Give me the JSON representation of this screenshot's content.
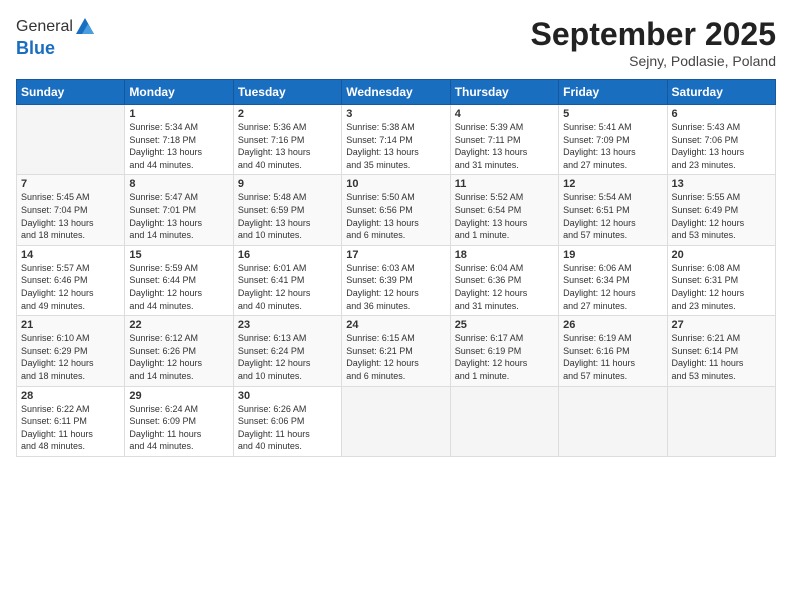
{
  "logo": {
    "general": "General",
    "blue": "Blue"
  },
  "header": {
    "month": "September 2025",
    "location": "Sejny, Podlasie, Poland"
  },
  "weekdays": [
    "Sunday",
    "Monday",
    "Tuesday",
    "Wednesday",
    "Thursday",
    "Friday",
    "Saturday"
  ],
  "weeks": [
    [
      {
        "day": "",
        "info": ""
      },
      {
        "day": "1",
        "info": "Sunrise: 5:34 AM\nSunset: 7:18 PM\nDaylight: 13 hours\nand 44 minutes."
      },
      {
        "day": "2",
        "info": "Sunrise: 5:36 AM\nSunset: 7:16 PM\nDaylight: 13 hours\nand 40 minutes."
      },
      {
        "day": "3",
        "info": "Sunrise: 5:38 AM\nSunset: 7:14 PM\nDaylight: 13 hours\nand 35 minutes."
      },
      {
        "day": "4",
        "info": "Sunrise: 5:39 AM\nSunset: 7:11 PM\nDaylight: 13 hours\nand 31 minutes."
      },
      {
        "day": "5",
        "info": "Sunrise: 5:41 AM\nSunset: 7:09 PM\nDaylight: 13 hours\nand 27 minutes."
      },
      {
        "day": "6",
        "info": "Sunrise: 5:43 AM\nSunset: 7:06 PM\nDaylight: 13 hours\nand 23 minutes."
      }
    ],
    [
      {
        "day": "7",
        "info": "Sunrise: 5:45 AM\nSunset: 7:04 PM\nDaylight: 13 hours\nand 18 minutes."
      },
      {
        "day": "8",
        "info": "Sunrise: 5:47 AM\nSunset: 7:01 PM\nDaylight: 13 hours\nand 14 minutes."
      },
      {
        "day": "9",
        "info": "Sunrise: 5:48 AM\nSunset: 6:59 PM\nDaylight: 13 hours\nand 10 minutes."
      },
      {
        "day": "10",
        "info": "Sunrise: 5:50 AM\nSunset: 6:56 PM\nDaylight: 13 hours\nand 6 minutes."
      },
      {
        "day": "11",
        "info": "Sunrise: 5:52 AM\nSunset: 6:54 PM\nDaylight: 13 hours\nand 1 minute."
      },
      {
        "day": "12",
        "info": "Sunrise: 5:54 AM\nSunset: 6:51 PM\nDaylight: 12 hours\nand 57 minutes."
      },
      {
        "day": "13",
        "info": "Sunrise: 5:55 AM\nSunset: 6:49 PM\nDaylight: 12 hours\nand 53 minutes."
      }
    ],
    [
      {
        "day": "14",
        "info": "Sunrise: 5:57 AM\nSunset: 6:46 PM\nDaylight: 12 hours\nand 49 minutes."
      },
      {
        "day": "15",
        "info": "Sunrise: 5:59 AM\nSunset: 6:44 PM\nDaylight: 12 hours\nand 44 minutes."
      },
      {
        "day": "16",
        "info": "Sunrise: 6:01 AM\nSunset: 6:41 PM\nDaylight: 12 hours\nand 40 minutes."
      },
      {
        "day": "17",
        "info": "Sunrise: 6:03 AM\nSunset: 6:39 PM\nDaylight: 12 hours\nand 36 minutes."
      },
      {
        "day": "18",
        "info": "Sunrise: 6:04 AM\nSunset: 6:36 PM\nDaylight: 12 hours\nand 31 minutes."
      },
      {
        "day": "19",
        "info": "Sunrise: 6:06 AM\nSunset: 6:34 PM\nDaylight: 12 hours\nand 27 minutes."
      },
      {
        "day": "20",
        "info": "Sunrise: 6:08 AM\nSunset: 6:31 PM\nDaylight: 12 hours\nand 23 minutes."
      }
    ],
    [
      {
        "day": "21",
        "info": "Sunrise: 6:10 AM\nSunset: 6:29 PM\nDaylight: 12 hours\nand 18 minutes."
      },
      {
        "day": "22",
        "info": "Sunrise: 6:12 AM\nSunset: 6:26 PM\nDaylight: 12 hours\nand 14 minutes."
      },
      {
        "day": "23",
        "info": "Sunrise: 6:13 AM\nSunset: 6:24 PM\nDaylight: 12 hours\nand 10 minutes."
      },
      {
        "day": "24",
        "info": "Sunrise: 6:15 AM\nSunset: 6:21 PM\nDaylight: 12 hours\nand 6 minutes."
      },
      {
        "day": "25",
        "info": "Sunrise: 6:17 AM\nSunset: 6:19 PM\nDaylight: 12 hours\nand 1 minute."
      },
      {
        "day": "26",
        "info": "Sunrise: 6:19 AM\nSunset: 6:16 PM\nDaylight: 11 hours\nand 57 minutes."
      },
      {
        "day": "27",
        "info": "Sunrise: 6:21 AM\nSunset: 6:14 PM\nDaylight: 11 hours\nand 53 minutes."
      }
    ],
    [
      {
        "day": "28",
        "info": "Sunrise: 6:22 AM\nSunset: 6:11 PM\nDaylight: 11 hours\nand 48 minutes."
      },
      {
        "day": "29",
        "info": "Sunrise: 6:24 AM\nSunset: 6:09 PM\nDaylight: 11 hours\nand 44 minutes."
      },
      {
        "day": "30",
        "info": "Sunrise: 6:26 AM\nSunset: 6:06 PM\nDaylight: 11 hours\nand 40 minutes."
      },
      {
        "day": "",
        "info": ""
      },
      {
        "day": "",
        "info": ""
      },
      {
        "day": "",
        "info": ""
      },
      {
        "day": "",
        "info": ""
      }
    ]
  ]
}
